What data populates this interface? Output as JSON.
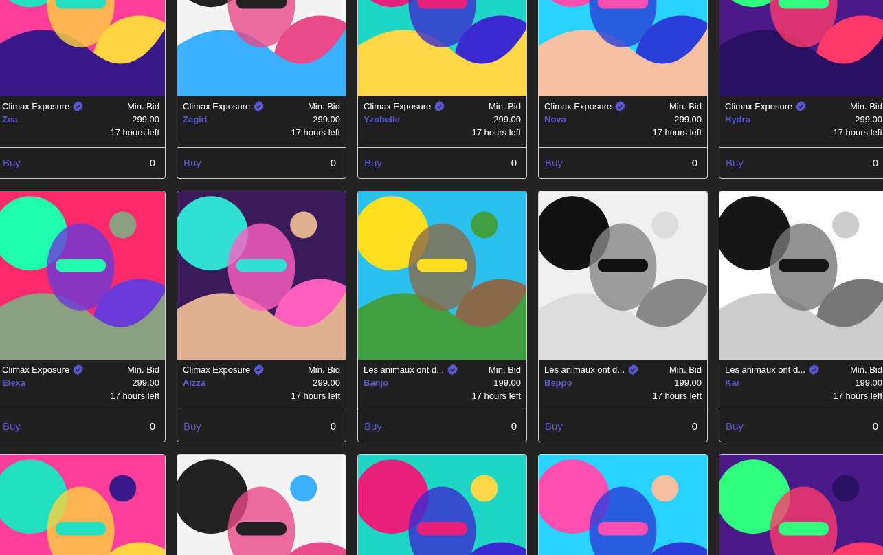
{
  "rows": [
    {
      "cards": [
        {
          "image": {
            "kind": "picture"
          },
          "collection": "Climax Exposure",
          "name": "Zea",
          "bid_label": "Min. Bid",
          "price": "299.00",
          "time_left": "17 hours left",
          "buy": "Buy",
          "count": "0"
        },
        {
          "image": {
            "kind": "picture"
          },
          "collection": "Climax Exposure",
          "name": "Zagiri",
          "bid_label": "Min. Bid",
          "price": "299.00",
          "time_left": "17 hours left",
          "buy": "Buy",
          "count": "0"
        },
        {
          "image": {
            "kind": "picture"
          },
          "collection": "Climax Exposure",
          "name": "Yzobelle",
          "bid_label": "Min. Bid",
          "price": "299.00",
          "time_left": "17 hours left",
          "buy": "Buy",
          "count": "0"
        },
        {
          "image": {
            "kind": "picture"
          },
          "collection": "Climax Exposure",
          "name": "Nova",
          "bid_label": "Min. Bid",
          "price": "299.00",
          "time_left": "17 hours left",
          "buy": "Buy",
          "count": "0"
        },
        {
          "image": {
            "kind": "picture"
          },
          "collection": "Climax Exposure",
          "name": "Hydra",
          "bid_label": "Min. Bid",
          "price": "299.00",
          "time_left": "17 hours left",
          "buy": "Buy",
          "count": "0"
        }
      ]
    },
    {
      "cards": [
        {
          "image": {
            "kind": "picture"
          },
          "collection": "Climax Exposure",
          "name": "Elexa",
          "bid_label": "Min. Bid",
          "price": "299.00",
          "time_left": "17 hours left",
          "buy": "Buy",
          "count": "0"
        },
        {
          "image": {
            "kind": "picture"
          },
          "collection": "Climax Exposure",
          "name": "Aizza",
          "bid_label": "Min. Bid",
          "price": "299.00",
          "time_left": "17 hours left",
          "buy": "Buy",
          "count": "0"
        },
        {
          "image": {
            "kind": "picture"
          },
          "collection": "Les animaux ont d...",
          "name": "Banjo",
          "bid_label": "Min. Bid",
          "price": "199.00",
          "time_left": "17 hours left",
          "buy": "Buy",
          "count": "0"
        },
        {
          "image": {
            "kind": "picture"
          },
          "collection": "Les animaux ont d...",
          "name": "Beppo",
          "bid_label": "Min. Bid",
          "price": "199.00",
          "time_left": "17 hours left",
          "buy": "Buy",
          "count": "0"
        },
        {
          "image": {
            "kind": "picture"
          },
          "collection": "Les animaux ont d...",
          "name": "Kar",
          "bid_label": "Min. Bid",
          "price": "199.00",
          "time_left": "17 hours left",
          "buy": "Buy",
          "count": "0"
        }
      ]
    },
    {
      "cards": [
        {
          "image": {
            "kind": "picture"
          }
        },
        {
          "image": {
            "kind": "picture"
          }
        },
        {
          "image": {
            "kind": "picture"
          }
        },
        {
          "image": {
            "kind": "picture"
          }
        },
        {
          "image": {
            "kind": "picture"
          }
        }
      ]
    }
  ]
}
